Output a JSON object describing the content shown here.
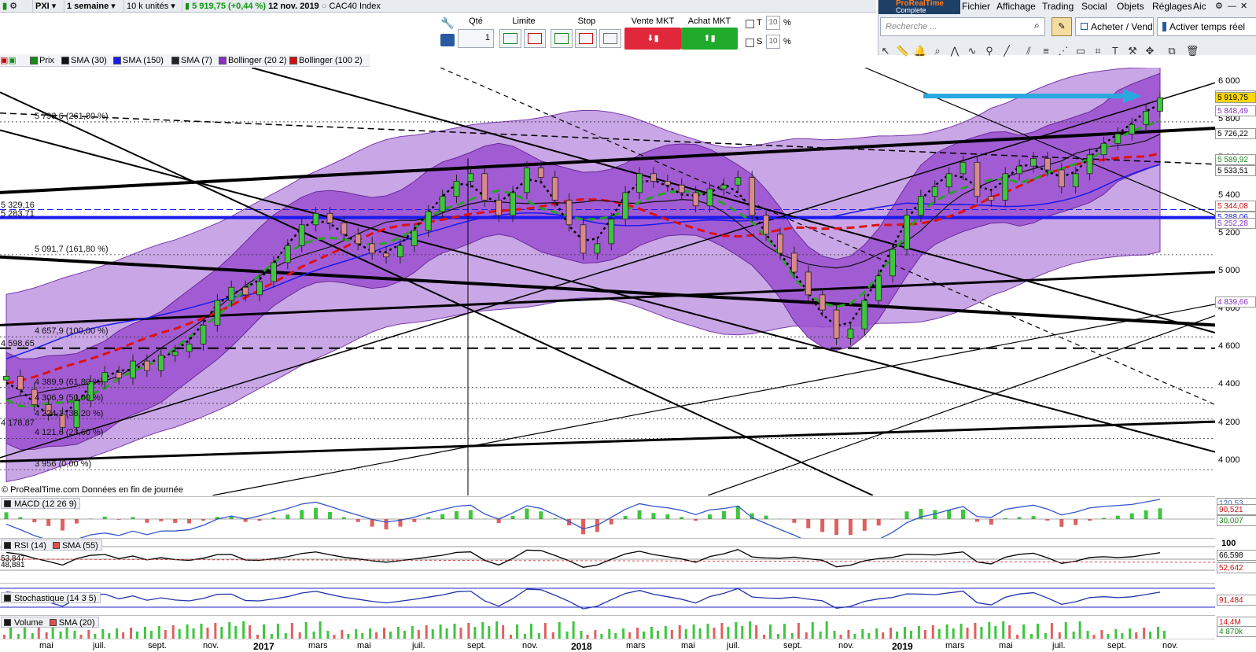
{
  "toolbar": {
    "ticker": "PXI",
    "timeframe": "1 semaine",
    "units": "10 k unités",
    "price_change": "5 919,75 (+0,44 %)",
    "date": "12 nov. 2019",
    "instrument": "CAC40 Index"
  },
  "orderbar": {
    "qty_label": "Qté",
    "qty_value": "1",
    "limit_label": "Limite",
    "stop_label": "Stop",
    "sell_label": "Vente MKT",
    "buy_label": "Achat MKT",
    "t_label": "T",
    "s_label": "S",
    "t_value": "10",
    "s_value": "10",
    "pct": "%"
  },
  "rpanel": {
    "brand_line1": "ProRealTime",
    "brand_line2": "Complete",
    "menu": [
      "Fichier",
      "Affichage",
      "Trading",
      "Social",
      "Objets",
      "Réglages",
      "Aic"
    ],
    "search_placeholder": "Recherche ...",
    "buy_sell": "Acheter / Vendre",
    "realtime": "Activer temps réel"
  },
  "legend": [
    {
      "label": "Prix",
      "color": "#1a8a1a"
    },
    {
      "label": "SMA (30)",
      "color": "#111111"
    },
    {
      "label": "SMA (150)",
      "color": "#1a1aee"
    },
    {
      "label": "SMA (7)",
      "color": "#222222"
    },
    {
      "label": "Bollinger (20 2)",
      "color": "#8a2fc0"
    },
    {
      "label": "Bollinger (100 2)",
      "color": "#cc1111"
    }
  ],
  "source": "© ProRealTime.com  Données en fin de journée",
  "panes": {
    "macd": {
      "label": "MACD (12 26 9)",
      "tags": [
        "120,53",
        "90,521",
        "30,007"
      ]
    },
    "rsi": {
      "label": "RSI (14)",
      "sma_label": "SMA (55)",
      "tags": [
        "100",
        "66,598",
        "52,642"
      ],
      "left_values": [
        "53,847",
        "48,881"
      ]
    },
    "stoch": {
      "label": "Stochastique (14 3 5)",
      "tags": [
        "91,484"
      ]
    },
    "volume": {
      "label": "Volume",
      "sma_label": "SMA (20)",
      "tags": [
        "14,4M",
        "4 870k"
      ]
    }
  },
  "fib_levels": [
    {
      "label": "5 793,6 (261,80 %)",
      "price": 5793.6
    },
    {
      "label": "5 091,7 (161,80 %)",
      "price": 5091.7
    },
    {
      "label": "4 657,9 (100,00 %)",
      "price": 4657.9
    },
    {
      "label": "4 389,9 (61,80 %)",
      "price": 4389.9
    },
    {
      "label": "4 306,9 (50,00 %)",
      "price": 4306.9
    },
    {
      "label": "4 224,1 (38,20 %)",
      "price": 4224.1
    },
    {
      "label": "4 121,6 (23,60 %)",
      "price": 4121.6
    },
    {
      "label": "3 956 (0,00 %)",
      "price": 3956
    }
  ],
  "left_levels": [
    {
      "label": "5 329,16",
      "price": 5329.16
    },
    {
      "label": "5 283,71",
      "price": 5283.71
    },
    {
      "label": "4 598,65",
      "price": 4598.65
    },
    {
      "label": "4 178,87",
      "price": 4178.87
    }
  ],
  "right_tags": [
    {
      "label": "5 927,55",
      "price": 5927.55,
      "bg": "#ffffff",
      "fg": "#8a2fc0"
    },
    {
      "label": "5 919,75",
      "price": 5919.75,
      "bg": "#ffd800",
      "fg": "#000000"
    },
    {
      "label": "5 848,49",
      "price": 5848.49,
      "bg": "#ffffff",
      "fg": "#8a2fc0"
    },
    {
      "label": "5 726,22",
      "price": 5726.22,
      "bg": "#ffffff",
      "fg": "#000000"
    },
    {
      "label": "5 589,92",
      "price": 5589.92,
      "bg": "#ffffff",
      "fg": "#1a8a1a"
    },
    {
      "label": "5 533,51",
      "price": 5533.51,
      "bg": "#ffffff",
      "fg": "#000000"
    },
    {
      "label": "5 344,08",
      "price": 5344.08,
      "bg": "#ffffff",
      "fg": "#cc1111"
    },
    {
      "label": "5 288,06",
      "price": 5288.06,
      "bg": "#ffffff",
      "fg": "#1a1aee"
    },
    {
      "label": "5 252,28",
      "price": 5252.28,
      "bg": "#ffffff",
      "fg": "#8a2fc0"
    },
    {
      "label": "4 839,66",
      "price": 4839.66,
      "bg": "#ffffff",
      "fg": "#8a2fc0"
    }
  ],
  "chart_data": {
    "type": "candlestick",
    "title": "CAC40 Index",
    "y_ticks": [
      6000,
      5800,
      5600,
      5400,
      5200,
      5000,
      4800,
      4600,
      4400,
      4200,
      4000
    ],
    "ylim": [
      3820,
      6080
    ],
    "x_labels": [
      "mai",
      "juil.",
      "sept.",
      "nov.",
      "2017",
      "mars",
      "mai",
      "juil.",
      "sept.",
      "nov.",
      "2018",
      "mars",
      "mai",
      "juil.",
      "sept.",
      "nov.",
      "2019",
      "mars",
      "mai",
      "juil.",
      "sept.",
      "nov."
    ],
    "x_years": [
      "2017",
      "2018",
      "2019"
    ],
    "close_series": [
      4450,
      4380,
      4300,
      4250,
      4180,
      4320,
      4420,
      4470,
      4440,
      4530,
      4480,
      4560,
      4580,
      4620,
      4720,
      4850,
      4920,
      4880,
      4950,
      5050,
      5140,
      5250,
      5310,
      5260,
      5200,
      5150,
      5100,
      5080,
      5140,
      5220,
      5320,
      5400,
      5480,
      5520,
      5380,
      5300,
      5420,
      5550,
      5500,
      5380,
      5250,
      5100,
      5150,
      5280,
      5420,
      5520,
      5480,
      5460,
      5420,
      5350,
      5440,
      5460,
      5500,
      5300,
      5200,
      5100,
      5000,
      4880,
      4800,
      4650,
      4700,
      4850,
      4980,
      5120,
      5300,
      5400,
      5450,
      5520,
      5580,
      5400,
      5380,
      5520,
      5560,
      5600,
      5540,
      5450,
      5520,
      5620,
      5680,
      5730,
      5780,
      5850,
      5920
    ],
    "series": [
      {
        "name": "SMA (30)",
        "values": [
          4560,
          4530,
          4500,
          4470,
          4450,
          4440,
          4450,
          4470,
          4500,
          4540,
          4590,
          4650,
          4720,
          4790,
          4860,
          4930,
          5000,
          5060,
          5110,
          5150,
          5180,
          5210,
          5250,
          5280,
          5300,
          5300,
          5300,
          5290,
          5300,
          5320,
          5340,
          5380,
          5410,
          5420,
          5410,
          5380,
          5350,
          5310,
          5270,
          5220,
          5160,
          5100,
          5030,
          4960,
          4910,
          4870,
          4860,
          4880,
          4920,
          4970,
          5030,
          5090,
          5150,
          5210,
          5260,
          5310,
          5350,
          5400,
          5440,
          5480,
          5520,
          5560,
          5620
        ]
      },
      {
        "name": "SMA (150)",
        "values": [
          4600,
          4600,
          4610,
          4610,
          4620,
          4630,
          4650,
          4670,
          4700,
          4720,
          4750,
          4770,
          4800,
          4820,
          4850,
          4880,
          4910,
          4930,
          4960,
          4980,
          5000,
          5010,
          5020,
          5040,
          5060,
          5080,
          5100,
          5130,
          5160,
          5200,
          5240,
          5280
        ]
      },
      {
        "name": "Bollinger (100 2) mid",
        "values": [
          4580,
          4570,
          4560,
          4560,
          4580,
          4620,
          4680,
          4740,
          4800,
          4880,
          4950,
          5030,
          5100,
          5160,
          5220,
          5250,
          5270,
          5280,
          5280,
          5285,
          5290,
          5300,
          5320,
          5340
        ]
      }
    ]
  }
}
